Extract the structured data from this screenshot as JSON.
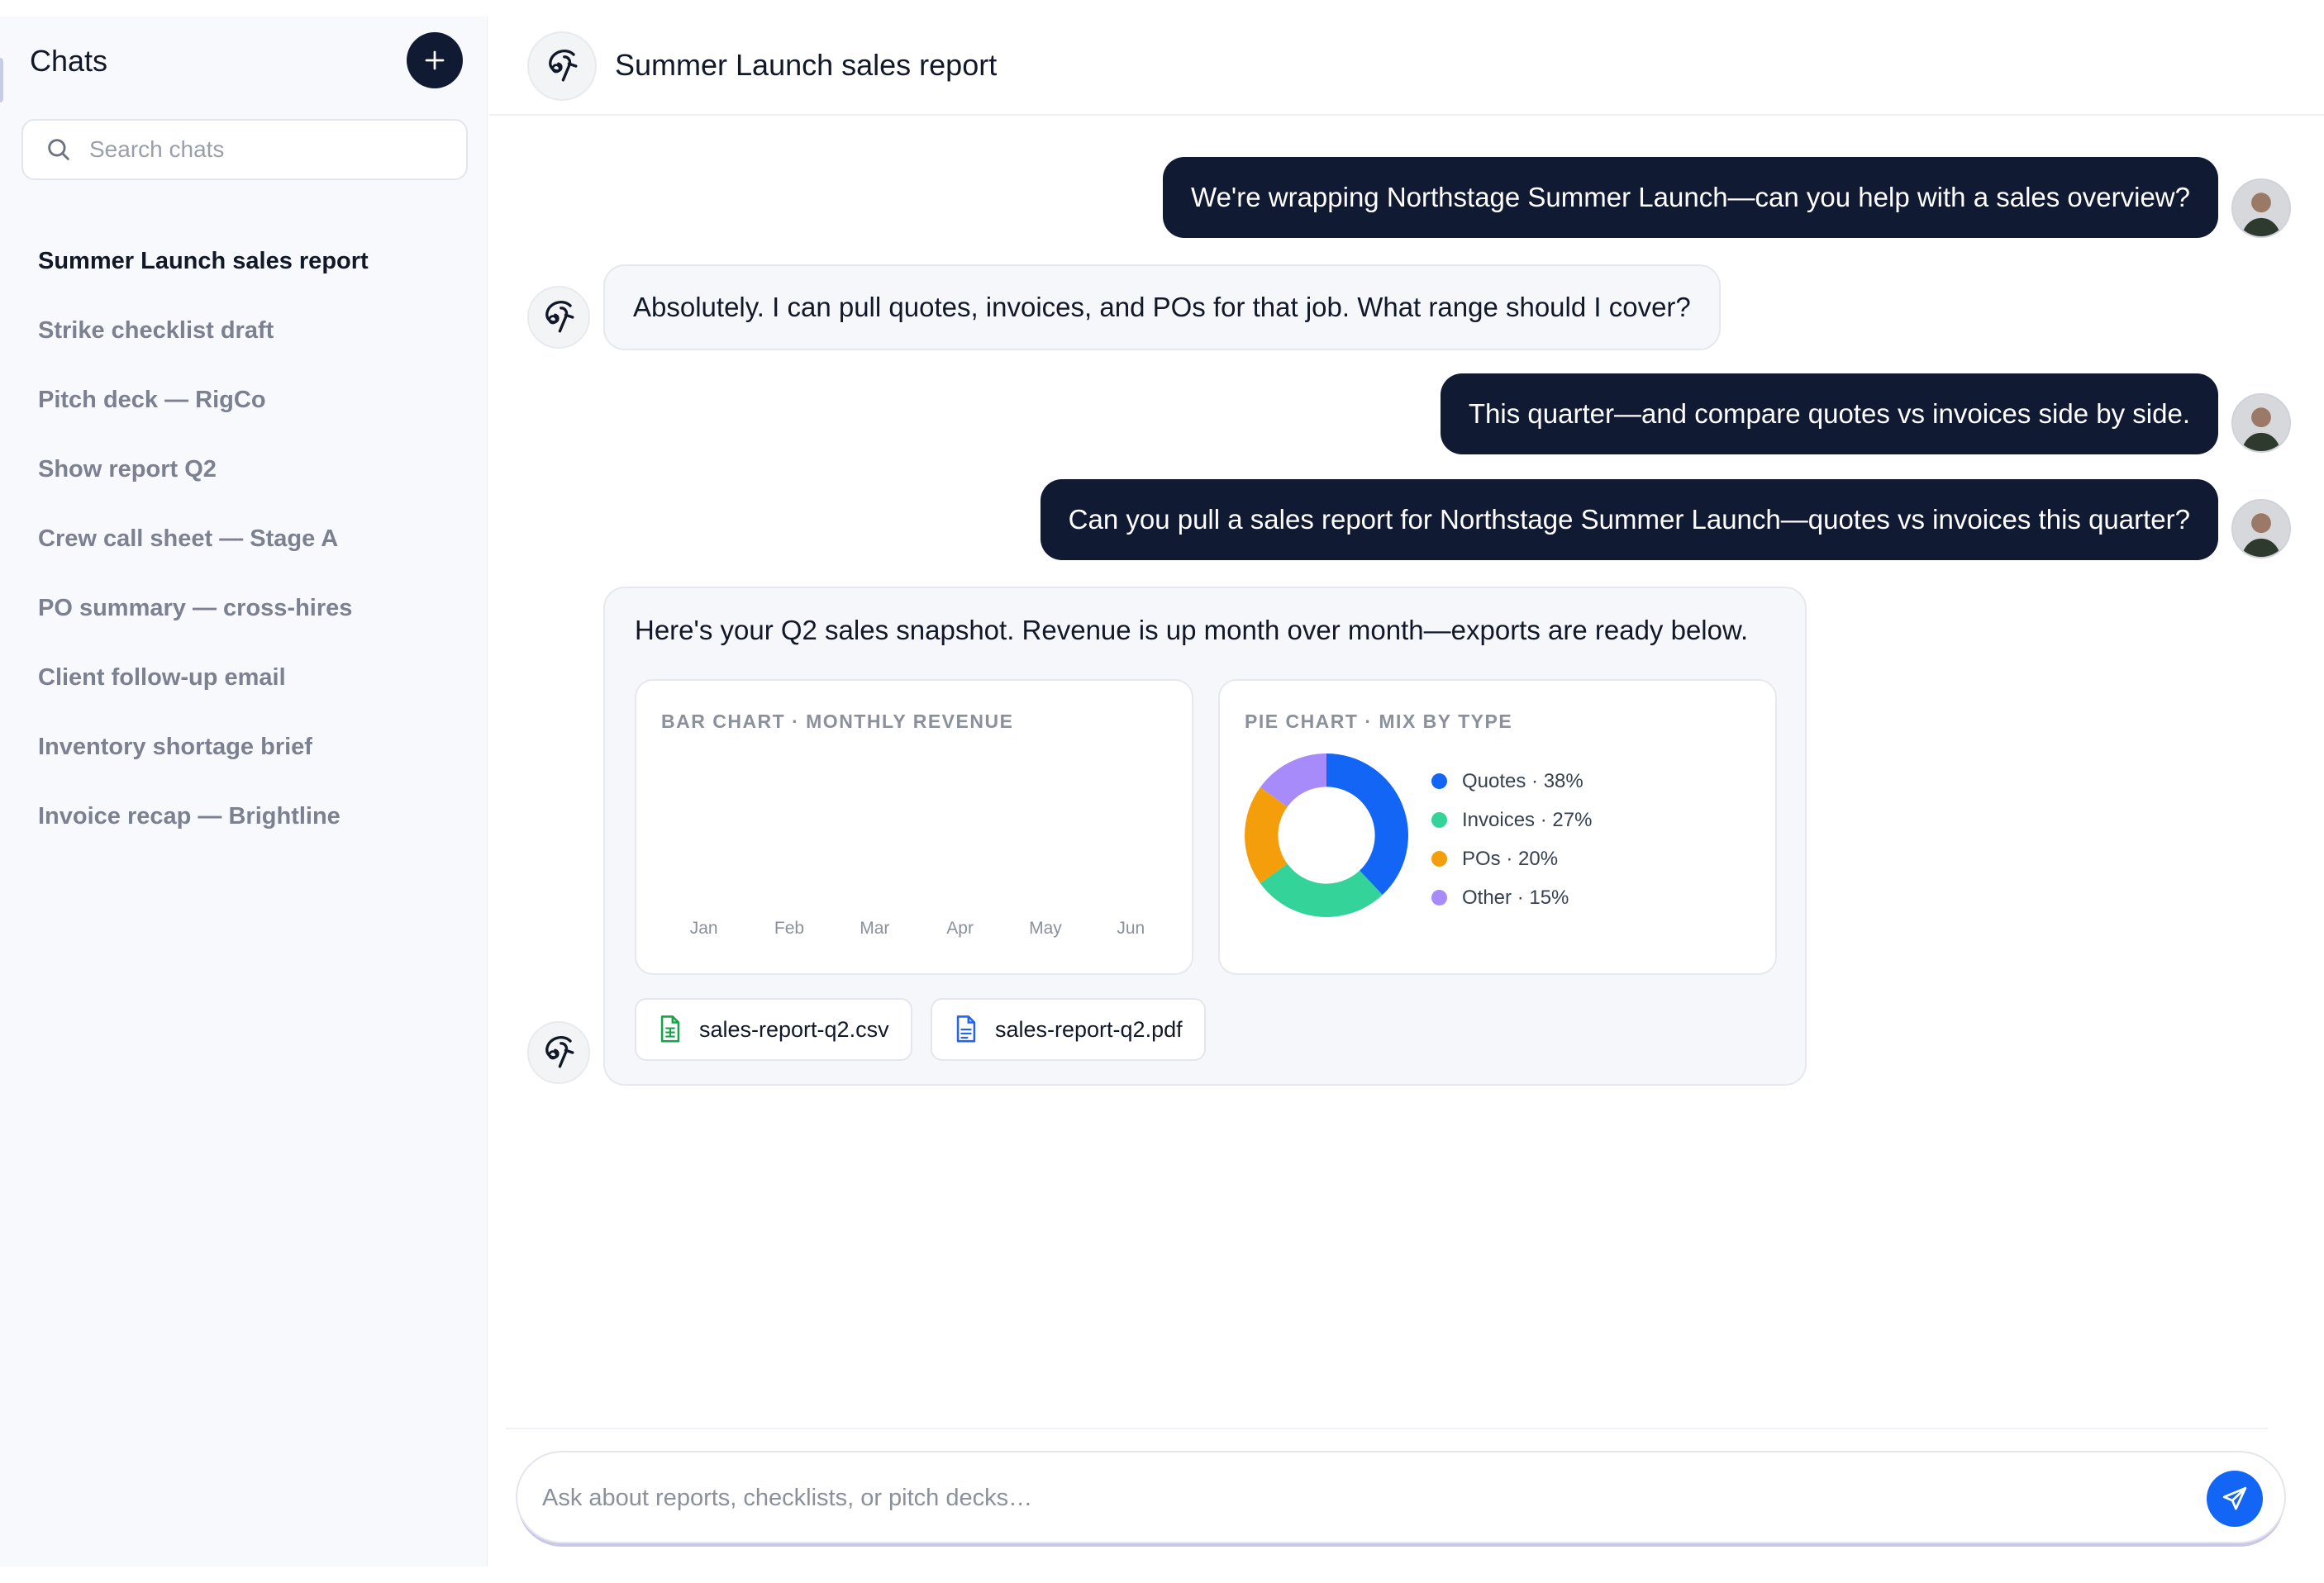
{
  "sidebar": {
    "title": "Chats",
    "new_chat_icon": "plus-icon",
    "search": {
      "placeholder": "Search chats",
      "value": ""
    },
    "items": [
      {
        "label": "Summer Launch sales report",
        "active": true
      },
      {
        "label": "Strike checklist draft",
        "active": false
      },
      {
        "label": "Pitch deck — RigCo",
        "active": false
      },
      {
        "label": "Show report Q2",
        "active": false
      },
      {
        "label": "Crew call sheet — Stage A",
        "active": false
      },
      {
        "label": "PO summary — cross-hires",
        "active": false
      },
      {
        "label": "Client follow-up email",
        "active": false
      },
      {
        "label": "Inventory shortage brief",
        "active": false
      },
      {
        "label": "Invoice recap — Brightline",
        "active": false
      }
    ]
  },
  "header": {
    "title": "Summer Launch sales report"
  },
  "messages": [
    {
      "role": "user",
      "text": "We're wrapping Northstage Summer Launch—can you help with a sales overview?"
    },
    {
      "role": "assistant",
      "text": "Absolutely. I can pull quotes, invoices, and POs for that job. What range should I cover?"
    },
    {
      "role": "user",
      "text": "This quarter—and compare quotes vs invoices side by side."
    },
    {
      "role": "user",
      "text": "Can you pull a sales report for Northstage Summer Launch—quotes vs invoices this quarter?"
    },
    {
      "role": "assistant",
      "text": "Here's your Q2 sales snapshot. Revenue is up month over month—exports are ready below."
    }
  ],
  "chart_data": [
    {
      "type": "bar",
      "title": "BAR CHART · MONTHLY REVENUE",
      "categories": [
        "Jan",
        "Feb",
        "Mar",
        "Apr",
        "May",
        "Jun"
      ],
      "values": []
    },
    {
      "type": "pie",
      "title": "PIE CHART · MIX BY TYPE",
      "donut": true,
      "slices": [
        {
          "label": "Quotes · 38%",
          "value": 38,
          "color": "#1366f5"
        },
        {
          "label": "Invoices · 27%",
          "value": 27,
          "color": "#34d399"
        },
        {
          "label": "POs · 20%",
          "value": 20,
          "color": "#f59e0b"
        },
        {
          "label": "Other · 15%",
          "value": 15,
          "color": "#a78bfa"
        }
      ]
    }
  ],
  "attachments": [
    {
      "name": "sales-report-q2.csv",
      "icon": "spreadsheet-file-icon",
      "color": "#16a34a"
    },
    {
      "name": "sales-report-q2.pdf",
      "icon": "document-file-icon",
      "color": "#2563eb"
    }
  ],
  "composer": {
    "placeholder": "Ask about reports, checklists, or pitch decks…",
    "value": "",
    "send_icon": "send-icon"
  },
  "colors": {
    "accent": "#1366f5",
    "user_bubble": "#111a33",
    "sidebar_bg": "#f8f9fc"
  }
}
